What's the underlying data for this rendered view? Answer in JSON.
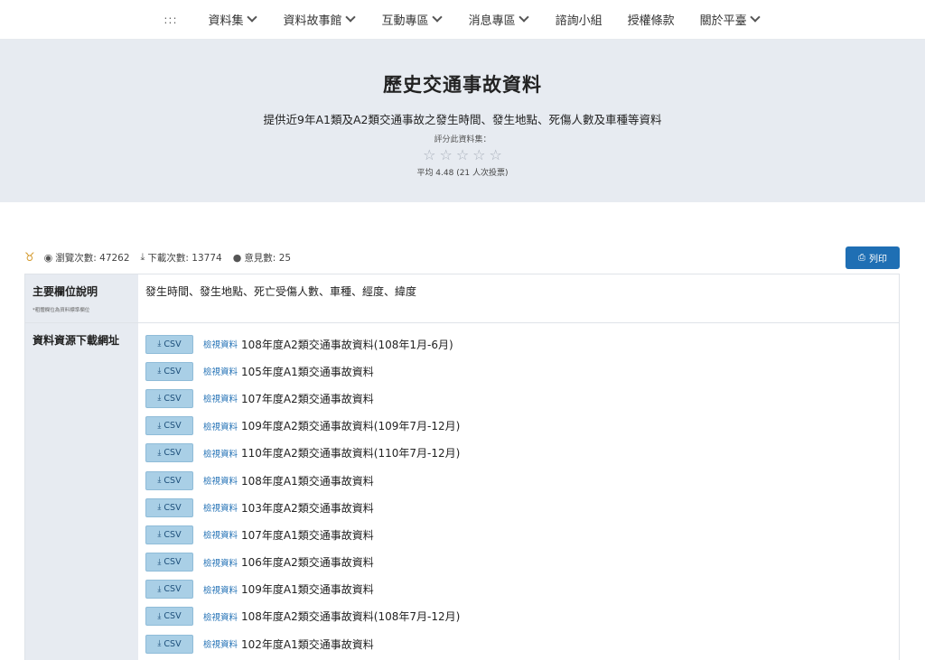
{
  "nav": {
    "dots": ":::",
    "items": [
      {
        "label": "資料集",
        "dropdown": true
      },
      {
        "label": "資料故事館",
        "dropdown": true
      },
      {
        "label": "互動專區",
        "dropdown": true
      },
      {
        "label": "消息專區",
        "dropdown": true
      },
      {
        "label": "諮詢小組",
        "dropdown": false
      },
      {
        "label": "授權條款",
        "dropdown": false
      },
      {
        "label": "關於平臺",
        "dropdown": true
      }
    ]
  },
  "hero": {
    "title": "歷史交通事故資料",
    "subtitle": "提供近9年A1類及A2類交通事故之發生時間、發生地點、死傷人數及車種等資料",
    "rate_label": "評分此資料集：",
    "stars": [
      "☆",
      "☆",
      "☆",
      "☆",
      "☆"
    ],
    "average": "平均 4.48 (21 人次投票)"
  },
  "stats": {
    "views": "瀏覽次數: 47262",
    "downloads": "下載次數: 13774",
    "comments": "意見數: 25",
    "print_label": "列印"
  },
  "table": {
    "fields_label": "主要欄位說明",
    "fields_note": "*粗體欄位為資料標準欄位",
    "fields_value": "發生時間、發生地點、死亡受傷人數、車種、經度、緯度",
    "resources_label": "資料資源下載網址",
    "csv_label": "CSV",
    "preview_label": "檢視資料",
    "resources": [
      "108年度A2類交通事故資料(108年1月-6月)",
      "105年度A1類交通事故資料",
      "107年度A2類交通事故資料",
      "109年度A2類交通事故資料(109年7月-12月)",
      "110年度A2類交通事故資料(110年7月-12月)",
      "108年度A1類交通事故資料",
      "103年度A2類交通事故資料",
      "107年度A1類交通事故資料",
      "106年度A2類交通事故資料",
      "109年度A1類交通事故資料",
      "108年度A2類交通事故資料(108年7月-12月)",
      "102年度A1類交通事故資料"
    ]
  }
}
